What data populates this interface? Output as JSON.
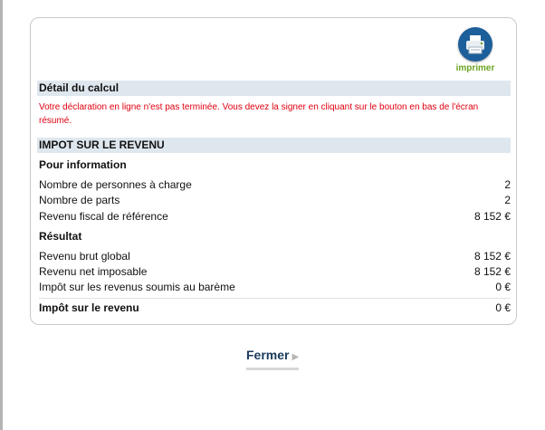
{
  "print": {
    "label": "imprimer",
    "icon": "printer-icon"
  },
  "detail": {
    "title": "Détail du calcul"
  },
  "warning": {
    "text": "Votre déclaration en ligne n'est pas terminée. Vous devez la signer en cliquant sur le bouton en bas de l'écran résumé."
  },
  "impot": {
    "title": "IMPOT SUR LE REVENU",
    "info": {
      "title": "Pour information",
      "rows": [
        {
          "label": "Nombre de personnes à charge",
          "value": "2"
        },
        {
          "label": "Nombre de parts",
          "value": "2"
        },
        {
          "label": "Revenu fiscal de référence",
          "value": "8 152 €"
        }
      ]
    },
    "resultat": {
      "title": "Résultat",
      "rows": [
        {
          "label": "Revenu brut global",
          "value": "8 152 €"
        },
        {
          "label": "Revenu net imposable",
          "value": "8 152 €"
        },
        {
          "label": "Impôt sur les revenus soumis au barème",
          "value": "0 €"
        }
      ]
    },
    "total": {
      "label": "Impôt sur le revenu",
      "value": "0 €"
    }
  },
  "close": {
    "label": "Fermer",
    "icon": "arrow-right-icon"
  },
  "colors": {
    "accent": "#1d5f9a",
    "warning": "#e1000f",
    "bar": "#dfe7ee",
    "print_label": "#6aa322"
  }
}
